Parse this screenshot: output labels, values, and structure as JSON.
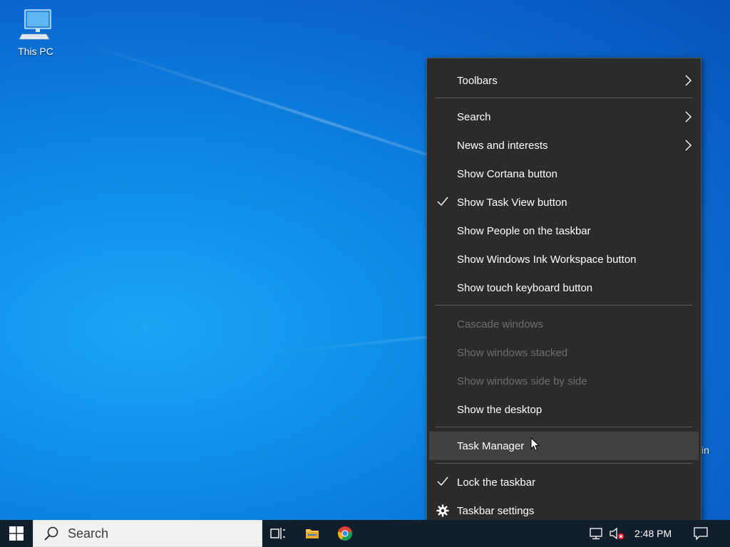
{
  "desktop": {
    "this_pc_label": "This PC",
    "partial_text": "in"
  },
  "taskbar": {
    "search_placeholder": "Search",
    "clock": "2:48 PM",
    "pinned": [
      "task-view",
      "file-explorer",
      "chrome"
    ]
  },
  "context_menu": {
    "toolbars": "Toolbars",
    "search": "Search",
    "news": "News and interests",
    "cortana": "Show Cortana button",
    "task_view": "Show Task View button",
    "people": "Show People on the taskbar",
    "ink": "Show Windows Ink Workspace button",
    "touch_keyboard": "Show touch keyboard button",
    "cascade": "Cascade windows",
    "stacked": "Show windows stacked",
    "side_by_side": "Show windows side by side",
    "show_desktop": "Show the desktop",
    "task_manager": "Task Manager",
    "lock_taskbar": "Lock the taskbar",
    "taskbar_settings": "Taskbar settings",
    "checked": [
      "Show Task View button",
      "Lock the taskbar"
    ],
    "disabled": [
      "Cascade windows",
      "Show windows stacked",
      "Show windows side by side"
    ],
    "hovered": "Task Manager"
  },
  "colors": {
    "menu_bg": "#2b2b2b",
    "menu_hover": "#414141",
    "taskbar_bg": "#101f2b",
    "disabled_text": "#6d6d6d"
  }
}
